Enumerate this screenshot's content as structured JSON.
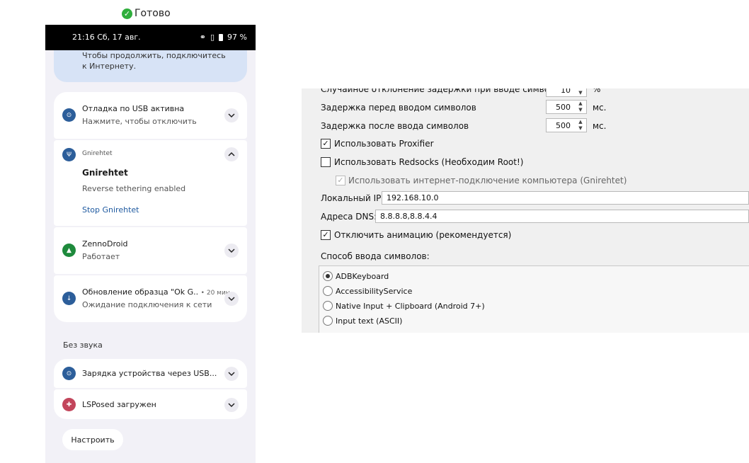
{
  "top_status": {
    "label": "Готово"
  },
  "phone": {
    "status_bar": {
      "time": "21:16 Сб, 17 авг.",
      "battery": "97 %"
    },
    "network_card": {
      "text": "Чтобы продолжить, подключитесь к Интернету."
    },
    "notifications": [
      {
        "title": "Отладка по USB активна",
        "subtitle": "Нажмите, чтобы отключить",
        "icon": "usb-debug-icon",
        "color": "#2c5e9a"
      },
      {
        "app": "Gnirehtet",
        "title": "Gnirehtet",
        "subtitle": "Reverse tethering enabled",
        "action": "Stop Gnirehtet",
        "icon": "usb-icon",
        "color": "#2c5e9a"
      },
      {
        "title": "ZennoDroid",
        "subtitle": "Работает",
        "icon": "zenno-icon",
        "color": "#1e8a3c"
      },
      {
        "title": "Обновление образца \"Ok G..",
        "time": "• 20 мин.",
        "subtitle": "Ожидание подключения к сети",
        "icon": "download-icon",
        "color": "#2c5e9a"
      }
    ],
    "silent_section": "Без звука",
    "silent_notifications": [
      {
        "title": "Зарядка устройства через USB...",
        "icon": "usb-debug-icon",
        "color": "#2c5e9a"
      },
      {
        "title": "LSPosed загружен",
        "icon": "lsposed-icon",
        "color": "#c2455b"
      }
    ],
    "customize_label": "Настроить"
  },
  "settings": {
    "partial_row": {
      "label": "Случайное отклонение задержки при вводе символов",
      "value": "10",
      "unit": "%"
    },
    "delay_before": {
      "label": "Задержка перед вводом символов",
      "value": "500",
      "unit": "мс."
    },
    "delay_after": {
      "label": "Задержка после ввода символов",
      "value": "500",
      "unit": "мс."
    },
    "use_proxifier": {
      "label": "Использовать Proxifier",
      "checked": true
    },
    "use_redsocks": {
      "label": "Использовать Redsocks (Необходим Root!)",
      "checked": false
    },
    "use_pc_internet": {
      "label": "Использовать интернет-подключение компьютера (Gnirehtet)",
      "checked": true,
      "disabled": true
    },
    "local_ip": {
      "label": "Локальный IP:",
      "value": "192.168.10.0"
    },
    "dns": {
      "label": "Адреса DNS:",
      "value": "8.8.8.8,8.8.4.4"
    },
    "disable_animation": {
      "label": "Отключить анимацию (рекомендуется)",
      "checked": true
    },
    "input_method": {
      "label": "Способ ввода символов:",
      "options": [
        "ADBKeyboard",
        "AccessibilityService",
        "Native Input + Clipboard (Android 7+)",
        "Input text (ASCII)"
      ],
      "selected": 0
    }
  }
}
